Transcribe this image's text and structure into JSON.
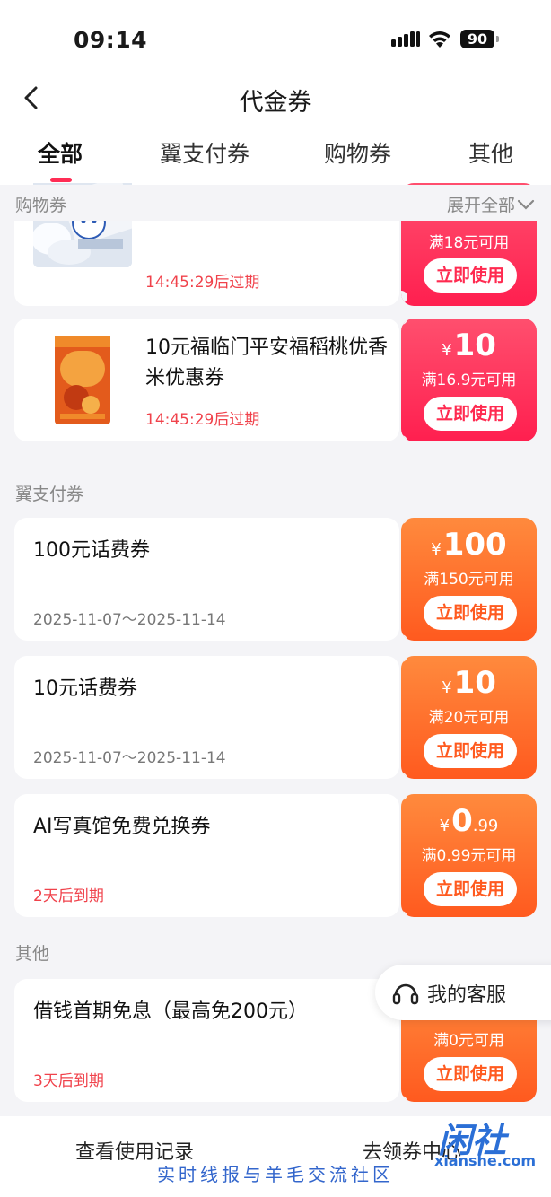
{
  "status_bar": {
    "time": "09:14",
    "battery": "90"
  },
  "nav": {
    "title": "代金券"
  },
  "tabs": [
    {
      "label": "全部",
      "active": true
    },
    {
      "label": "翼支付券",
      "active": false
    },
    {
      "label": "购物券",
      "active": false
    },
    {
      "label": "其他",
      "active": false
    }
  ],
  "sections": {
    "shopping": {
      "label": "购物券",
      "expand": "展开全部"
    },
    "yizhifu": {
      "label": "翼支付券"
    },
    "other": {
      "label": "其他"
    }
  },
  "shopping_coupons": [
    {
      "title": "",
      "expiry": "14:45:29后过期",
      "amount": "",
      "condition": "满18元可用",
      "button": "立即使用"
    },
    {
      "title": "10元福临门平安福稻桃优香米优惠券",
      "expiry": "14:45:29后过期",
      "amount": "10",
      "condition": "满16.9元可用",
      "button": "立即使用"
    }
  ],
  "yizhifu_coupons": [
    {
      "title": "100元话费券",
      "dates": "2025-11-07～2025-11-14",
      "amount": "100",
      "condition": "满150元可用",
      "button": "立即使用"
    },
    {
      "title": "10元话费券",
      "dates": "2025-11-07～2025-11-14",
      "amount": "10",
      "condition": "满20元可用",
      "button": "立即使用"
    },
    {
      "title": "AI写真馆免费兑换券",
      "expiry": "2天后到期",
      "amount_int": "0",
      "amount_dec": ".99",
      "condition": "满0.99元可用",
      "button": "立即使用"
    }
  ],
  "other_coupons": [
    {
      "title": "借钱首期免息（最高免200元）",
      "expiry": "3天后到期",
      "condition": "满0元可用",
      "button": "立即使用"
    }
  ],
  "currency_symbol": "¥",
  "customer_service": {
    "label": "我的客服"
  },
  "bottom_bar": {
    "history": "查看使用记录",
    "go_claim": "去领券中心"
  },
  "watermark": {
    "logo": "闲社",
    "site": "xianshe.com",
    "slogan": "实时线报与羊毛交流社区"
  },
  "colors": {
    "accent_red": "#ff2d55",
    "stub_red": "#ff1f4f",
    "stub_orange": "#ff5a1f",
    "expiry_red": "#f0424b"
  }
}
